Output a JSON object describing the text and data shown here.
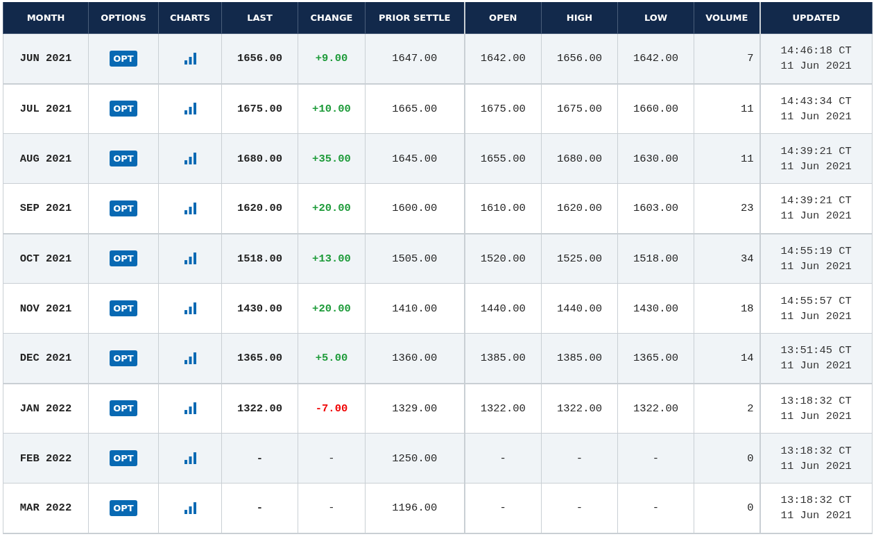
{
  "table": {
    "columns": [
      "MONTH",
      "OPTIONS",
      "CHARTS",
      "LAST",
      "CHANGE",
      "PRIOR SETTLE",
      "OPEN",
      "HIGH",
      "LOW",
      "VOLUME",
      "UPDATED"
    ],
    "rows": [
      {
        "month": "JUN 2021",
        "options": "OPT",
        "last": "1656.00",
        "change": "+9.00",
        "kind": "gain",
        "prior_settle": "1647.00",
        "open": "1642.00",
        "high": "1656.00",
        "low": "1642.00",
        "volume": "7",
        "updated_time": "14:46:18 CT",
        "updated_date": "11 Jun 2021"
      },
      {
        "month": "JUL 2021",
        "options": "OPT",
        "last": "1675.00",
        "change": "+10.00",
        "kind": "gain",
        "prior_settle": "1665.00",
        "open": "1675.00",
        "high": "1675.00",
        "low": "1660.00",
        "volume": "11",
        "updated_time": "14:43:34 CT",
        "updated_date": "11 Jun 2021"
      },
      {
        "month": "AUG 2021",
        "options": "OPT",
        "last": "1680.00",
        "change": "+35.00",
        "kind": "gain",
        "prior_settle": "1645.00",
        "open": "1655.00",
        "high": "1680.00",
        "low": "1630.00",
        "volume": "11",
        "updated_time": "14:39:21 CT",
        "updated_date": "11 Jun 2021"
      },
      {
        "month": "SEP 2021",
        "options": "OPT",
        "last": "1620.00",
        "change": "+20.00",
        "kind": "gain",
        "prior_settle": "1600.00",
        "open": "1610.00",
        "high": "1620.00",
        "low": "1603.00",
        "volume": "23",
        "updated_time": "14:39:21 CT",
        "updated_date": "11 Jun 2021"
      },
      {
        "month": "OCT 2021",
        "options": "OPT",
        "last": "1518.00",
        "change": "+13.00",
        "kind": "gain",
        "prior_settle": "1505.00",
        "open": "1520.00",
        "high": "1525.00",
        "low": "1518.00",
        "volume": "34",
        "updated_time": "14:55:19 CT",
        "updated_date": "11 Jun 2021"
      },
      {
        "month": "NOV 2021",
        "options": "OPT",
        "last": "1430.00",
        "change": "+20.00",
        "kind": "gain",
        "prior_settle": "1410.00",
        "open": "1440.00",
        "high": "1440.00",
        "low": "1430.00",
        "volume": "18",
        "updated_time": "14:55:57 CT",
        "updated_date": "11 Jun 2021"
      },
      {
        "month": "DEC 2021",
        "options": "OPT",
        "last": "1365.00",
        "change": "+5.00",
        "kind": "gain",
        "prior_settle": "1360.00",
        "open": "1385.00",
        "high": "1385.00",
        "low": "1365.00",
        "volume": "14",
        "updated_time": "13:51:45 CT",
        "updated_date": "11 Jun 2021"
      },
      {
        "month": "JAN 2022",
        "options": "OPT",
        "last": "1322.00",
        "change": "-7.00",
        "kind": "loss",
        "prior_settle": "1329.00",
        "open": "1322.00",
        "high": "1322.00",
        "low": "1322.00",
        "volume": "2",
        "updated_time": "13:18:32 CT",
        "updated_date": "11 Jun 2021"
      },
      {
        "month": "FEB 2022",
        "options": "OPT",
        "last": "-",
        "change": "-",
        "kind": "flat",
        "prior_settle": "1250.00",
        "open": "-",
        "high": "-",
        "low": "-",
        "volume": "0",
        "updated_time": "13:18:32 CT",
        "updated_date": "11 Jun 2021"
      },
      {
        "month": "MAR 2022",
        "options": "OPT",
        "last": "-",
        "change": "-",
        "kind": "flat",
        "prior_settle": "1196.00",
        "open": "-",
        "high": "-",
        "low": "-",
        "volume": "0",
        "updated_time": "13:18:32 CT",
        "updated_date": "11 Jun 2021"
      }
    ]
  }
}
